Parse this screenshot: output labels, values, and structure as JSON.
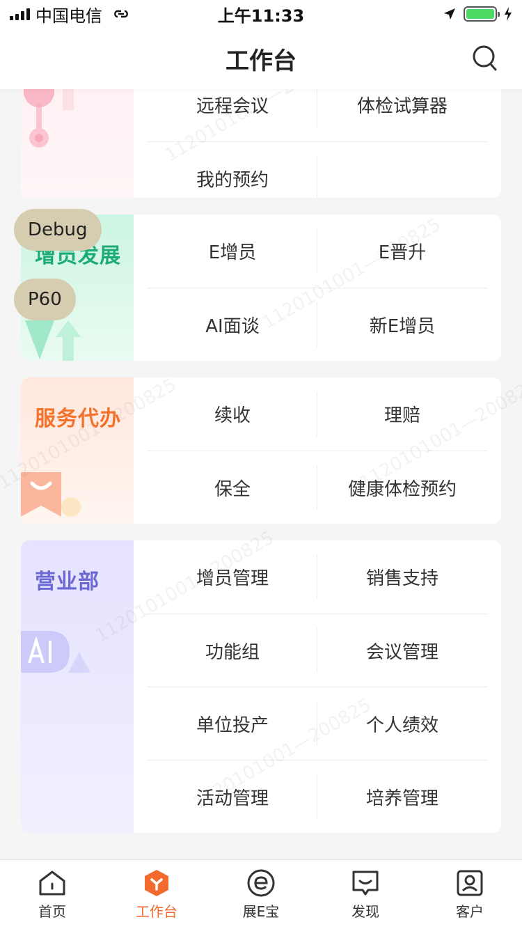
{
  "status_bar": {
    "carrier": "中国电信",
    "time": "上午11:33"
  },
  "nav": {
    "title": "工作台"
  },
  "cards": [
    {
      "title": "",
      "items": [
        "远程会议",
        "体检试算器",
        "我的预约",
        ""
      ]
    },
    {
      "title": "增员发展",
      "items": [
        "E增员",
        "E晋升",
        "AI面谈",
        "新E增员"
      ]
    },
    {
      "title": "服务代办",
      "items": [
        "续收",
        "理赔",
        "保全",
        "健康体检预约"
      ]
    },
    {
      "title": "营业部",
      "items": [
        "增员管理",
        "销售支持",
        "功能组",
        "会议管理",
        "单位投产",
        "个人绩效",
        "活动管理",
        "培养管理"
      ]
    }
  ],
  "debug": {
    "debug_label": "Debug",
    "p60_label": "P60"
  },
  "watermark": "1120101001—200825",
  "tabs": [
    {
      "label": "首页",
      "icon": "home-icon"
    },
    {
      "label": "工作台",
      "icon": "workbench-icon"
    },
    {
      "label": "展E宝",
      "icon": "e-treasure-icon"
    },
    {
      "label": "发现",
      "icon": "discover-icon"
    },
    {
      "label": "客户",
      "icon": "customer-icon"
    }
  ],
  "colors": {
    "accent": "#f26a2e",
    "green_title": "#1dab74",
    "orange_title": "#f4722b",
    "purple_title": "#6b68d3"
  }
}
